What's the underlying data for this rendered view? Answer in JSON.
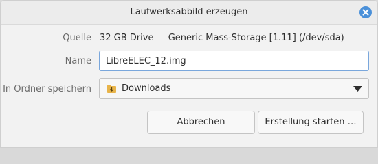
{
  "dialog": {
    "title": "Laufwerksabbild erzeugen",
    "close_icon": "close-icon",
    "accent_color": "#4a90d9"
  },
  "form": {
    "source_label": "Quelle",
    "source_value": "32 GB Drive — Generic Mass-Storage [1.11] (/dev/sda)",
    "name_label": "Name",
    "name_value": "LibreELEC_12.img",
    "folder_label": "In Ordner speichern",
    "folder_value": "Downloads",
    "folder_icon": "download-folder-icon"
  },
  "buttons": {
    "cancel_label": "Abbrechen",
    "start_label": "Erstellung starten …"
  }
}
